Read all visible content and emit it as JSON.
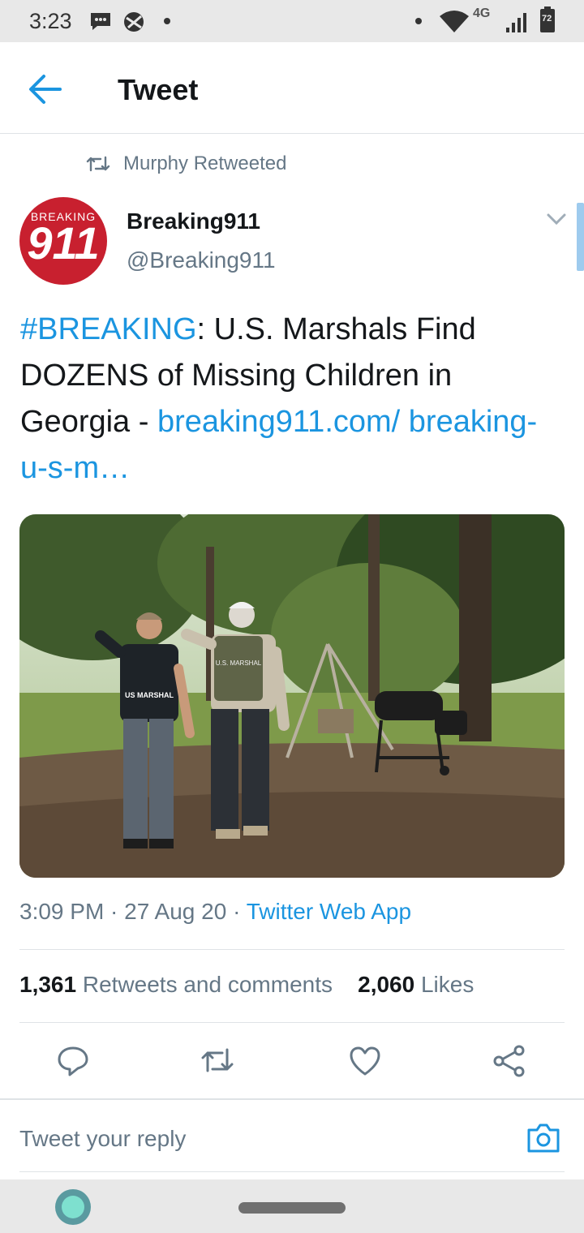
{
  "status": {
    "time": "3:23",
    "network": "4G",
    "battery": "72"
  },
  "header": {
    "title": "Tweet"
  },
  "retweet": {
    "label": "Murphy Retweeted"
  },
  "author": {
    "avatar_text_top": "BREAKING",
    "avatar_text_main": "911",
    "name": "Breaking911",
    "handle": "@Breaking911"
  },
  "tweet": {
    "hashtag": "#BREAKING",
    "text": ": U.S. Marshals Find DOZENS of Missing Children in Georgia - ",
    "link": "breaking911.com/ breaking-u-s-m…"
  },
  "media": {
    "vest_label_1": "US MARSHAL",
    "vest_label_2": "U.S. MARSHAL"
  },
  "meta": {
    "time": "3:09 PM",
    "sep1": " · ",
    "date": "27 Aug 20",
    "sep2": " · ",
    "source": "Twitter Web App"
  },
  "stats": {
    "retweets_count": "1,361",
    "retweets_label": "Retweets and comments",
    "likes_count": "2,060",
    "likes_label": "Likes"
  },
  "reply": {
    "placeholder": "Tweet your reply"
  },
  "colors": {
    "accent": "#1b95e0",
    "muted": "#657786",
    "brand_red": "#c8202f"
  }
}
